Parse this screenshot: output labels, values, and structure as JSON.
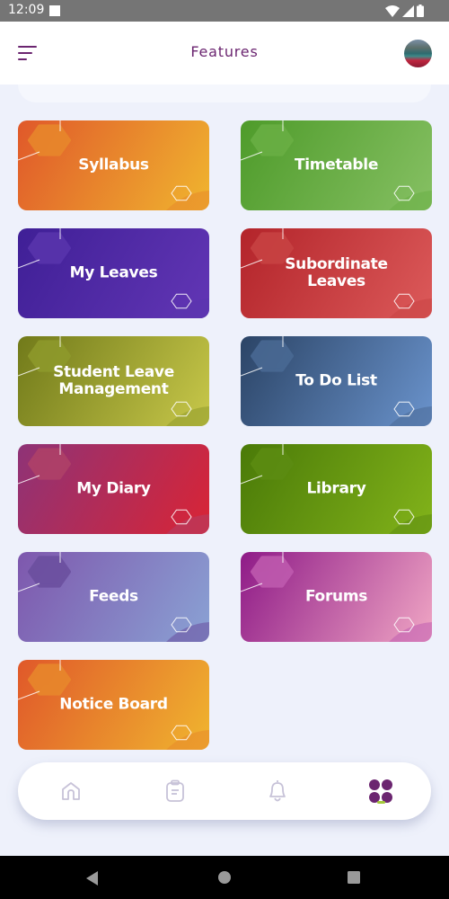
{
  "status_bar": {
    "time": "12:09",
    "icons": [
      "wifi-icon",
      "signal-icon",
      "battery-icon"
    ]
  },
  "header": {
    "title": "Features",
    "menu_icon": "menu-sort-icon",
    "avatar_icon": "user-avatar"
  },
  "colors": {
    "accent": "#6b2570",
    "active_indicator": "#a3c83a",
    "background": "#eef1fb",
    "nav_icon_inactive": "#c7c2d8"
  },
  "features": [
    {
      "label": "Syllabus",
      "gradient": [
        "#e0582a",
        "#f0b52f"
      ],
      "accent": "#e8892c"
    },
    {
      "label": "Timetable",
      "gradient": [
        "#4e9b2a",
        "#86c063"
      ],
      "accent": "#6aaf45"
    },
    {
      "label": "My Leaves",
      "gradient": [
        "#3f1f96",
        "#6236b5"
      ],
      "accent": "#5a35ad"
    },
    {
      "label": "Subordinate Leaves",
      "gradient": [
        "#b3242a",
        "#dc5a5a"
      ],
      "accent": "#c84444"
    },
    {
      "label": "Student Leave Management",
      "gradient": [
        "#717a1a",
        "#c8c84a"
      ],
      "accent": "#8f9a2c"
    },
    {
      "label": "To Do List",
      "gradient": [
        "#2b4466",
        "#6a93cc"
      ],
      "accent": "#4a6a95"
    },
    {
      "label": "My Diary",
      "gradient": [
        "#8e3377",
        "#d92435"
      ],
      "accent": "#b04268"
    },
    {
      "label": "Library",
      "gradient": [
        "#4a7a08",
        "#82b31a"
      ],
      "accent": "#5c8c12"
    },
    {
      "label": "Feeds",
      "gradient": [
        "#7e57ad",
        "#8aa2d4"
      ],
      "accent": "#6a4e9e"
    },
    {
      "label": "Forums",
      "gradient": [
        "#8e1a87",
        "#f0a6c4"
      ],
      "accent": "#c05cb0"
    },
    {
      "label": "Notice Board",
      "gradient": [
        "#e0582a",
        "#f0b52f"
      ],
      "accent": "#e8892c"
    }
  ],
  "bottom_nav": [
    {
      "name": "home",
      "icon": "home-icon",
      "active": false
    },
    {
      "name": "tasks",
      "icon": "clipboard-icon",
      "active": false
    },
    {
      "name": "notifications",
      "icon": "bell-icon",
      "active": false
    },
    {
      "name": "features",
      "icon": "grid-icon",
      "active": true
    }
  ],
  "system_nav": [
    "back",
    "home",
    "recents"
  ]
}
